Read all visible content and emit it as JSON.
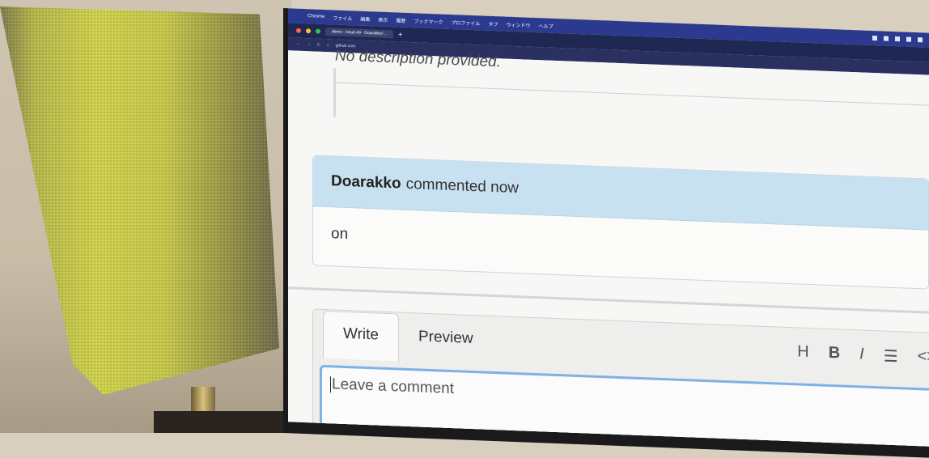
{
  "menubar": {
    "app": "Chrome",
    "items": [
      "ファイル",
      "編集",
      "表示",
      "履歴",
      "ブックマーク",
      "プロファイル",
      "タブ",
      "ウィンドウ",
      "ヘルプ"
    ]
  },
  "browser": {
    "tab_title": "demo · Issue #9 · Doarakko/…",
    "url": "github.com"
  },
  "issue": {
    "description": "No description provided."
  },
  "comment": {
    "author": "Doarakko",
    "meta": "commented now",
    "body": "on"
  },
  "editor": {
    "tab_write": "Write",
    "tab_preview": "Preview",
    "toolbar": [
      "H",
      "B",
      "I",
      "list",
      "code"
    ],
    "placeholder": "Leave a comment"
  },
  "colors": {
    "comment_header": "#c8e1f0",
    "focus_border": "#7fb0e6",
    "menubar": "#2b3a8f"
  }
}
